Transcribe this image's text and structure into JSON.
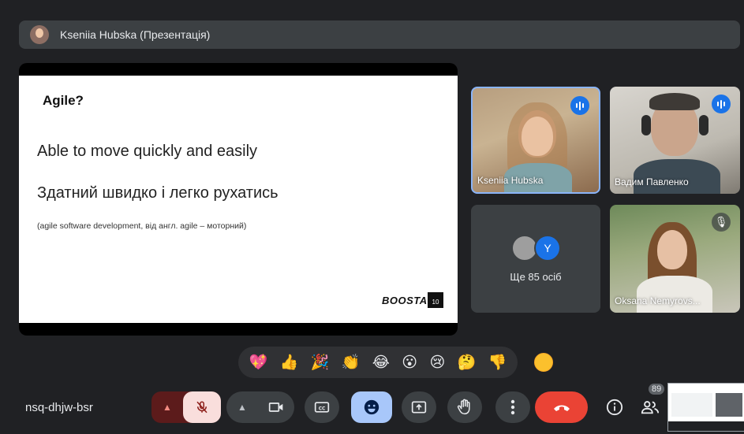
{
  "presenter_banner": {
    "text": "Kseniia Hubska (Презентація)"
  },
  "slide": {
    "heading": "Agile?",
    "line1": "Able to move quickly and easily",
    "line2": "Здатний швидко і легко рухатись",
    "note": "(agile software development, від англ. agile – моторний)",
    "logo_text": "BOOSTA",
    "logo_number": "10"
  },
  "tiles": {
    "kseniia": {
      "name": "Kseniia Hubska",
      "speaking": true
    },
    "vadym": {
      "name": "Вадим Павленко",
      "speaking": true
    },
    "more": {
      "avatar_letter": "Y",
      "text": "Ще 85 осіб"
    },
    "oksana": {
      "name": "Oksana Nemyrovs...",
      "muted": true
    }
  },
  "reactions": [
    "💖",
    "👍",
    "🎉",
    "👏",
    "😂",
    "😮",
    "😢",
    "🤔",
    "👎"
  ],
  "bottom_bar": {
    "meeting_code": "nsq-dhjw-bsr",
    "people_count": "89"
  },
  "colors": {
    "background": "#202124",
    "accent_blue": "#1a73e8",
    "leave_red": "#ea4335",
    "mic_off_bg": "#f9dedc",
    "emoji_active": "#a8c7fa"
  },
  "icons": {
    "mic": "mic-off-icon",
    "camera": "videocam-icon",
    "captions": "closed-caption-icon",
    "emoji": "emoji-icon",
    "present": "present-screen-icon",
    "hand": "raise-hand-icon",
    "more": "more-vert-icon",
    "leave": "call-end-icon",
    "info": "info-icon",
    "people": "people-icon"
  }
}
